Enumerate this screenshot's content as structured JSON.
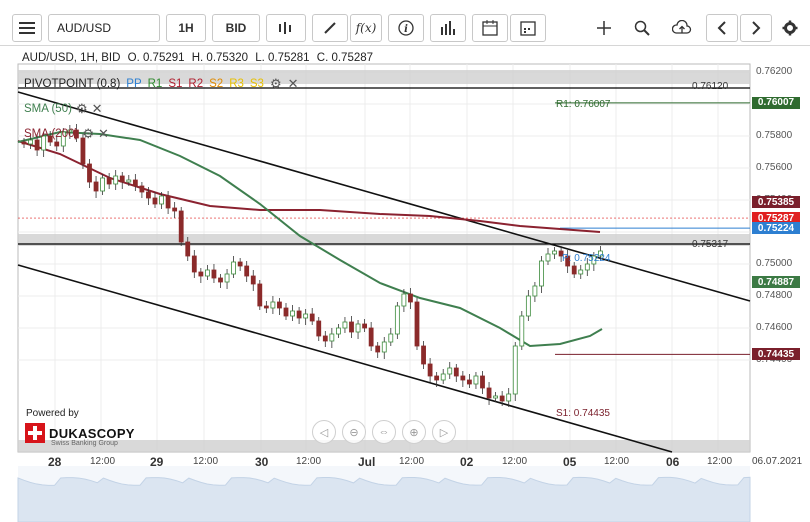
{
  "toolbar": {
    "symbol": "AUD/USD",
    "timeframe": "1H",
    "price_side": "BID",
    "buttons": [
      {
        "name": "menu-icon"
      },
      {
        "name": "candles-icon"
      },
      {
        "name": "draw-icon"
      },
      {
        "name": "function-icon",
        "label": "f(x)"
      },
      {
        "name": "info-icon"
      },
      {
        "name": "bar-chart-icon"
      },
      {
        "name": "calendar-icon"
      },
      {
        "name": "crosshair-icon"
      },
      {
        "name": "zoom-icon"
      },
      {
        "name": "cloud-upload-icon"
      },
      {
        "name": "arrow-left-icon"
      },
      {
        "name": "arrow-right-icon"
      },
      {
        "name": "gear-icon"
      }
    ]
  },
  "header": {
    "instrument": "AUD/USD, 1H, BID",
    "open": "O. 0.75291",
    "high": "H. 0.75320",
    "low": "L. 0.75281",
    "close": "C. 0.75287"
  },
  "indicators": {
    "pivot": {
      "label": "PIVOTPOINT (0,8)",
      "pp": "PP",
      "r1": "R1",
      "s1": "S1",
      "r2": "R2",
      "s2": "S2",
      "r3": "R3",
      "s3": "S3"
    },
    "sma50": {
      "label": "SMA (50)"
    },
    "sma200": {
      "label": "SMA (200)"
    }
  },
  "levels": {
    "r1_label": "R1: 0.76007",
    "pp_label": "P: 0.75224",
    "s1_label": "S1: 0.74435",
    "h1_label": "0.76120",
    "h2_label": "0.75317"
  },
  "price_tags": [
    {
      "text": "0.76007",
      "color": "#2f6b2f",
      "value": 0.76007
    },
    {
      "text": "0.75385",
      "color": "#7a1f2b",
      "value": 0.75385
    },
    {
      "text": "0.75287",
      "color": "#e02020",
      "value": 0.75287
    },
    {
      "text": "0.75224",
      "color": "#2d7fd1",
      "value": 0.75224
    },
    {
      "text": "0.74887",
      "color": "#3c7a44",
      "value": 0.74887
    },
    {
      "text": "0.74435",
      "color": "#7a1f2b",
      "value": 0.74435
    }
  ],
  "y_axis": [
    "0.76200",
    "0.75800",
    "0.75600",
    "0.75400",
    "0.75000",
    "0.74800",
    "0.74600",
    "0.74400"
  ],
  "x_axis": [
    {
      "t": "28",
      "big": true
    },
    {
      "t": "12:00"
    },
    {
      "t": "29",
      "big": true
    },
    {
      "t": "12:00"
    },
    {
      "t": "30",
      "big": true
    },
    {
      "t": "12:00"
    },
    {
      "t": "Jul",
      "big": true
    },
    {
      "t": "12:00"
    },
    {
      "t": "02",
      "big": true
    },
    {
      "t": "12:00"
    },
    {
      "t": "05",
      "big": true
    },
    {
      "t": "12:00"
    },
    {
      "t": "06",
      "big": true
    },
    {
      "t": "12:00"
    },
    {
      "t": "06.07.2021"
    }
  ],
  "branding": {
    "powered_by": "Powered by",
    "brand": "DUKASCOPY",
    "tagline": "Swiss Banking Group"
  },
  "colors": {
    "sma50": "#3f7f4f",
    "sma200": "#8b2230",
    "channel": "#111111",
    "band": "#c8c8c8"
  }
}
